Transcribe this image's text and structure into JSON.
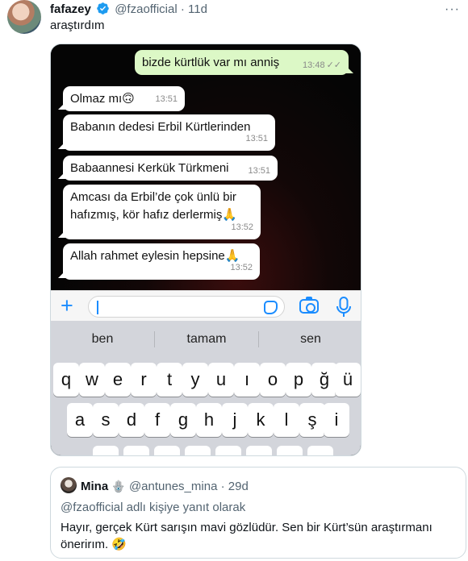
{
  "tweet": {
    "display_name": "fafazey",
    "handle": "@fzaofficial",
    "separator": "·",
    "time": "11d",
    "text": "araştırdım"
  },
  "chat": {
    "outgoing": {
      "text": "bizde kürtlük var mı anniş",
      "time": "13:48"
    },
    "incoming": [
      {
        "text": "Olmaz mı🙃",
        "time": "13:51"
      },
      {
        "text": "Babanın dedesi Erbil Kürtlerinden",
        "time": "13:51"
      },
      {
        "text": "Babaannesi Kerkük Türkmeni",
        "time": "13:51"
      },
      {
        "line1": "Amcası da Erbil’de çok ünlü bir",
        "line2": "hafızmış, kör hafız derlermiş🙏",
        "time": "13:52"
      },
      {
        "text": "Allah rahmet eylesin hepsine🙏",
        "time": "13:52"
      }
    ]
  },
  "keyboard": {
    "suggestions": [
      "ben",
      "tamam",
      "sen"
    ],
    "row1": [
      "q",
      "w",
      "e",
      "r",
      "t",
      "y",
      "u",
      "ı",
      "o",
      "p",
      "ğ",
      "ü"
    ],
    "row2": [
      "a",
      "s",
      "d",
      "f",
      "g",
      "h",
      "j",
      "k",
      "l",
      "ş",
      "i"
    ]
  },
  "quote": {
    "display_name": "Mina",
    "handle": "@antunes_mina",
    "separator": "·",
    "time": "29d",
    "reply_context": "@fzaofficial adlı kişiye yanıt olarak",
    "text": "Hayır, gerçek Kürt sarışın mavi gözlüdür. Sen bir Kürt’sün araştırmanı önerirım. 🤣"
  },
  "colors": {
    "verified": "#1d9bf0",
    "whatsapp_out_bubble": "#dcf8c6",
    "ios_blue": "#1a8cff",
    "secondary_text": "#536471"
  },
  "icons": [
    "verified-badge-icon",
    "more-icon",
    "plus-icon",
    "sticker-icon",
    "camera-icon",
    "mic-icon",
    "hamsa-icon"
  ]
}
